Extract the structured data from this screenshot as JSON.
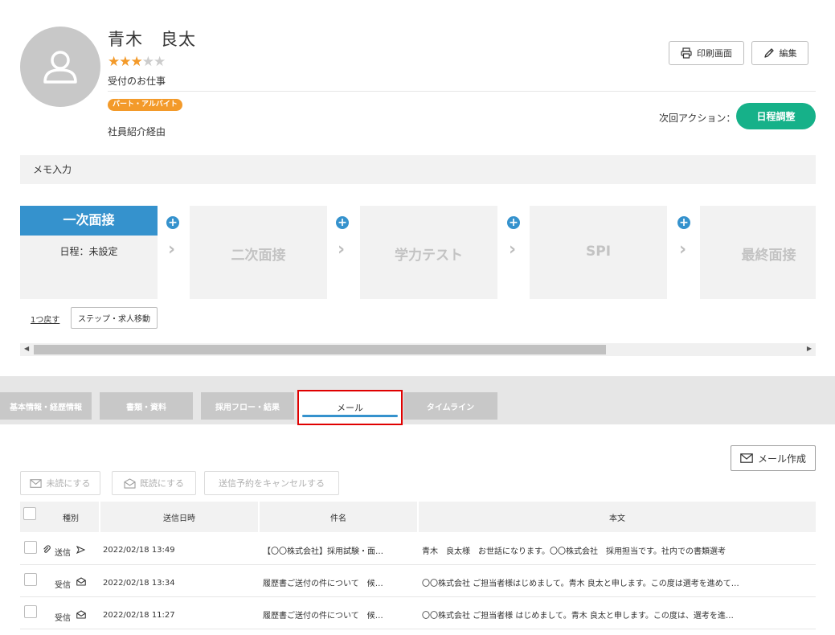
{
  "profile": {
    "name": "青木　良太",
    "rating": 3,
    "rating_max": 5,
    "job": "受付のお仕事",
    "employment_badge": "パート・アルバイト",
    "route": "社員紹介経由"
  },
  "header_actions": {
    "print_label": "印刷画面",
    "edit_label": "編集",
    "next_action_label": "次回アクション：",
    "next_action_button": "日程調整"
  },
  "memo": {
    "label": "メモ入力"
  },
  "steps": [
    {
      "label": "一次面接",
      "sub": "日程：未設定",
      "active": true
    },
    {
      "label": "二次面接",
      "active": false
    },
    {
      "label": "学力テスト",
      "active": false
    },
    {
      "label": "SPI",
      "active": false
    },
    {
      "label": "最終面接",
      "active": false
    }
  ],
  "step_controls": {
    "back_label": "1つ戻す",
    "move_label": "ステップ・求人移動"
  },
  "tabs": [
    {
      "label": "基本情報・経歴情報"
    },
    {
      "label": "書類・資料"
    },
    {
      "label": "採用フロー・結果"
    },
    {
      "label": "メール",
      "active": true
    },
    {
      "label": "タイムライン"
    }
  ],
  "mail_toolbar": {
    "create_label": "メール作成",
    "mark_unread_label": "未読にする",
    "mark_read_label": "既読にする",
    "cancel_schedule_label": "送信予約をキャンセルする"
  },
  "mail_table": {
    "columns": [
      "種別",
      "送信日時",
      "件名",
      "本文"
    ],
    "rows": [
      {
        "type": "送信",
        "attachment": true,
        "date": "2022/02/18 13:49",
        "subject": "【〇〇株式会社】採用試験・面…",
        "body": "青木　良太様　お世話になります。〇〇株式会社　採用担当です。社内での書類選考"
      },
      {
        "type": "受信",
        "attachment": false,
        "date": "2022/02/18 13:34",
        "subject": "履歴書ご送付の件について　候…",
        "body": "〇〇株式会社 ご担当者様はじめまして。青木 良太と申します。この度は選考を進めて…"
      },
      {
        "type": "受信",
        "attachment": false,
        "date": "2022/02/18 11:27",
        "subject": "履歴書ご送付の件について　候…",
        "body": "〇〇株式会社 ご担当者様 はじめまして。青木 良太と申します。この度は、選考を進…"
      }
    ]
  },
  "colors": {
    "accent_blue": "#3592cd",
    "star_orange": "#f39a2a",
    "next_action_green": "#16b189",
    "highlight_red": "#e00000"
  }
}
